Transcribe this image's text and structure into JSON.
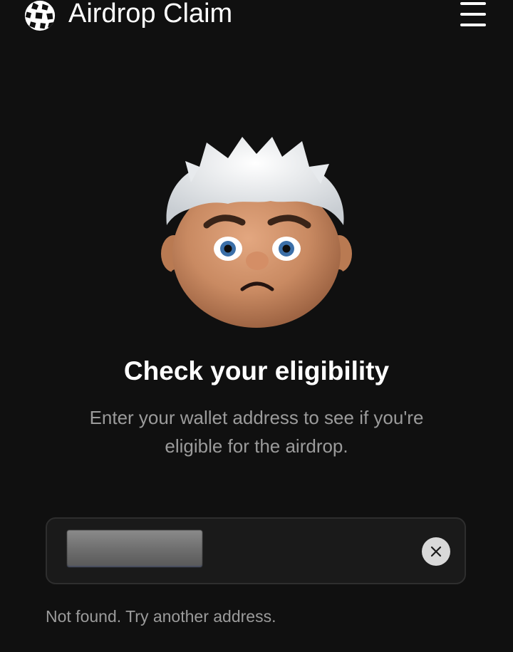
{
  "header": {
    "title": "Airdrop Claim",
    "logo_icon": "sphere-logo-icon",
    "menu_icon": "hamburger-menu-icon"
  },
  "main": {
    "avatar_icon": "sad-cartoon-face-icon",
    "heading": "Check your eligibility",
    "subtext": "Enter your wallet address to see if you're eligible for the airdrop."
  },
  "wallet_input": {
    "value": "",
    "value_redacted": true,
    "clear_icon": "close-icon"
  },
  "status": {
    "message": "Not found. Try another address."
  },
  "colors": {
    "background": "#101010",
    "text_primary": "#ffffff",
    "text_secondary": "#9b9b9b",
    "input_border": "#2e2e2e",
    "clear_button": "#d9d9d9"
  }
}
